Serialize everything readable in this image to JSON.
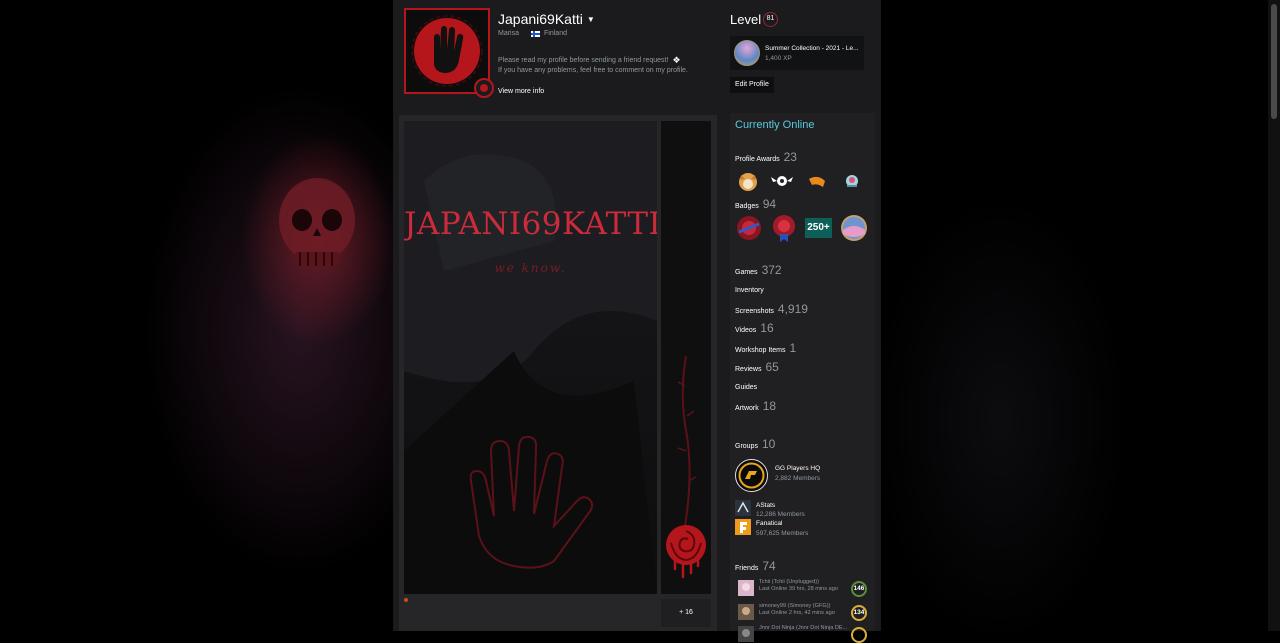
{
  "profile": {
    "persona_name": "Japani69Katti",
    "real_name": "Marisa",
    "country": "Finland",
    "summary_line1": "Please read my profile before sending a friend request!",
    "summary_line2": "If you have any problems, feel free to comment on my profile.",
    "view_more": "View more info"
  },
  "level": {
    "label": "Level",
    "value": "81"
  },
  "favorite_badge": {
    "name": "Summer Collection - 2021 - Le...",
    "xp": "1,400 XP"
  },
  "edit_profile": "Edit Profile",
  "artwork_showcase": {
    "title_text": "JAPANI69KATTI",
    "tagline": "we know.",
    "more": "+ 16"
  },
  "sidebar": {
    "status": "Currently Online",
    "awards": {
      "label": "Profile Awards",
      "count": "23"
    },
    "badges": {
      "label": "Badges",
      "count": "94",
      "badge3_text": "250+"
    },
    "links": [
      {
        "label": "Games",
        "count": "372"
      },
      {
        "label": "Inventory",
        "count": ""
      },
      {
        "label": "Screenshots",
        "count": "4,919"
      },
      {
        "label": "Videos",
        "count": "16"
      },
      {
        "label": "Workshop Items",
        "count": "1"
      },
      {
        "label": "Reviews",
        "count": "65"
      },
      {
        "label": "Guides",
        "count": ""
      },
      {
        "label": "Artwork",
        "count": "18"
      }
    ],
    "groups": {
      "label": "Groups",
      "count": "10",
      "items": [
        {
          "name": "GG Players HQ",
          "members": "2,882 Members"
        },
        {
          "name": "AStats",
          "members": "12,286 Members"
        },
        {
          "name": "Fanatical",
          "members": "597,625 Members"
        }
      ]
    },
    "friends": {
      "label": "Friends",
      "count": "74",
      "items": [
        {
          "name": "Tchii (Tchii (Unplugged))",
          "status": "Last Online 39 hrs, 28 mins ago",
          "level": "146",
          "level_color": "#5a8f3c"
        },
        {
          "name": "simoney99 (Simoney (GFG))",
          "status": "Last Online 2 hrs, 42 mins ago",
          "level": "134",
          "level_color": "#d8b234"
        },
        {
          "name": "Jnnr Dot Ninja (Jnnr Dot Ninja DE...",
          "status": "",
          "level": "",
          "level_color": "#d8b234"
        }
      ]
    }
  }
}
